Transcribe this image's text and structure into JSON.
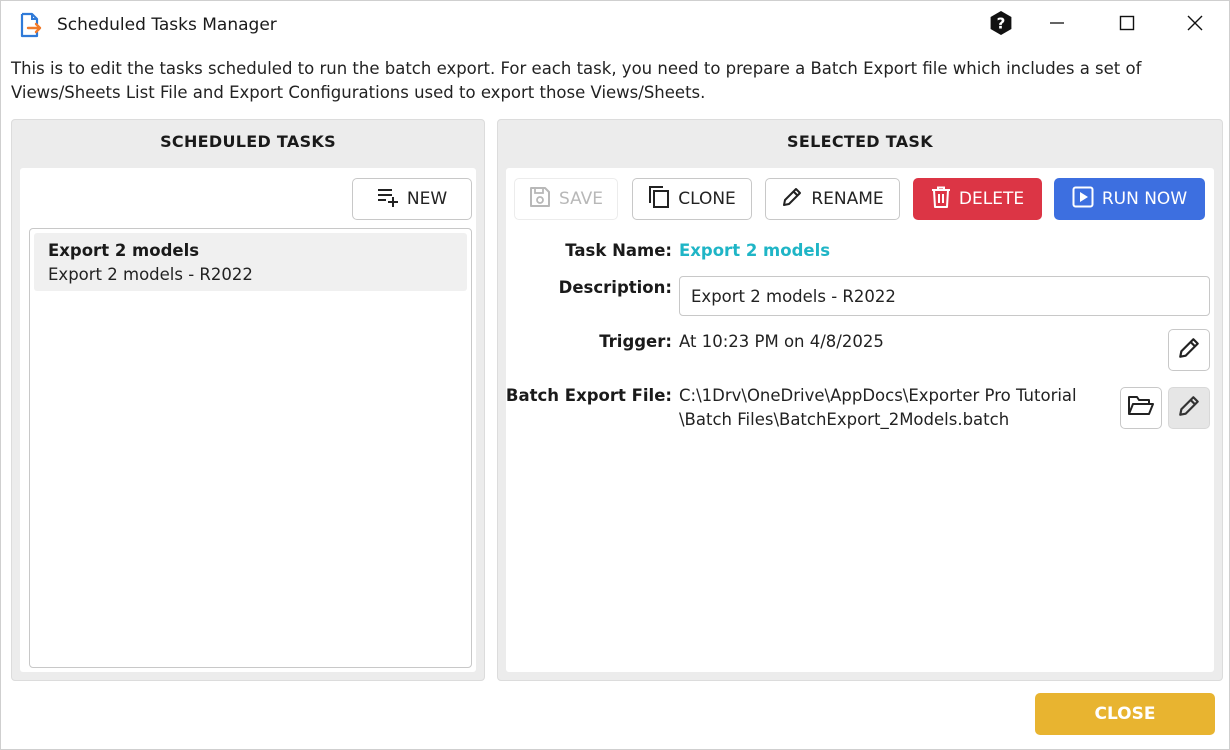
{
  "window": {
    "title": "Scheduled Tasks Manager"
  },
  "intro_text": "This is to edit the tasks scheduled to run the batch export. For each task, you need to prepare a Batch Export file which includes a set of Views/Sheets List File and Export Configurations used to export those Views/Sheets.",
  "left_panel": {
    "header": "SCHEDULED TASKS",
    "new_label": "NEW",
    "tasks": [
      {
        "title": "Export 2 models",
        "description": "Export 2 models - R2022"
      }
    ]
  },
  "right_panel": {
    "header": "SELECTED TASK",
    "toolbar": {
      "save_label": "SAVE",
      "clone_label": "CLONE",
      "rename_label": "RENAME",
      "delete_label": "DELETE",
      "run_now_label": "RUN NOW"
    },
    "task_name_label": "Task Name:",
    "task_name_value": "Export 2 models",
    "description_label": "Description:",
    "description_value": "Export 2 models - R2022",
    "trigger_label": "Trigger:",
    "trigger_value": "At 10:23 PM on 4/8/2025",
    "batch_file_label": "Batch Export File:",
    "batch_file_line1": "C:\\1Drv\\OneDrive\\AppDocs\\Exporter Pro Tutorial",
    "batch_file_line2": "\\Batch Files\\BatchExport_2Models.batch"
  },
  "footer": {
    "close_label": "CLOSE"
  },
  "colors": {
    "accent_teal": "#1fb5c6",
    "delete_red": "#dc3545",
    "run_blue": "#3d6fe0",
    "close_yellow": "#e8b430",
    "app_icon_blue": "#2f7ad8",
    "app_icon_orange": "#f07a2a"
  },
  "icons": {
    "app": "export-document-icon",
    "help": "help-icon",
    "minimize": "minimize-icon",
    "maximize": "maximize-icon",
    "close": "close-icon",
    "new": "playlist-add-icon",
    "save": "save-icon",
    "clone": "copy-icon",
    "rename": "pencil-icon",
    "delete": "trash-icon",
    "run": "play-box-icon",
    "folder": "folder-open-icon"
  }
}
